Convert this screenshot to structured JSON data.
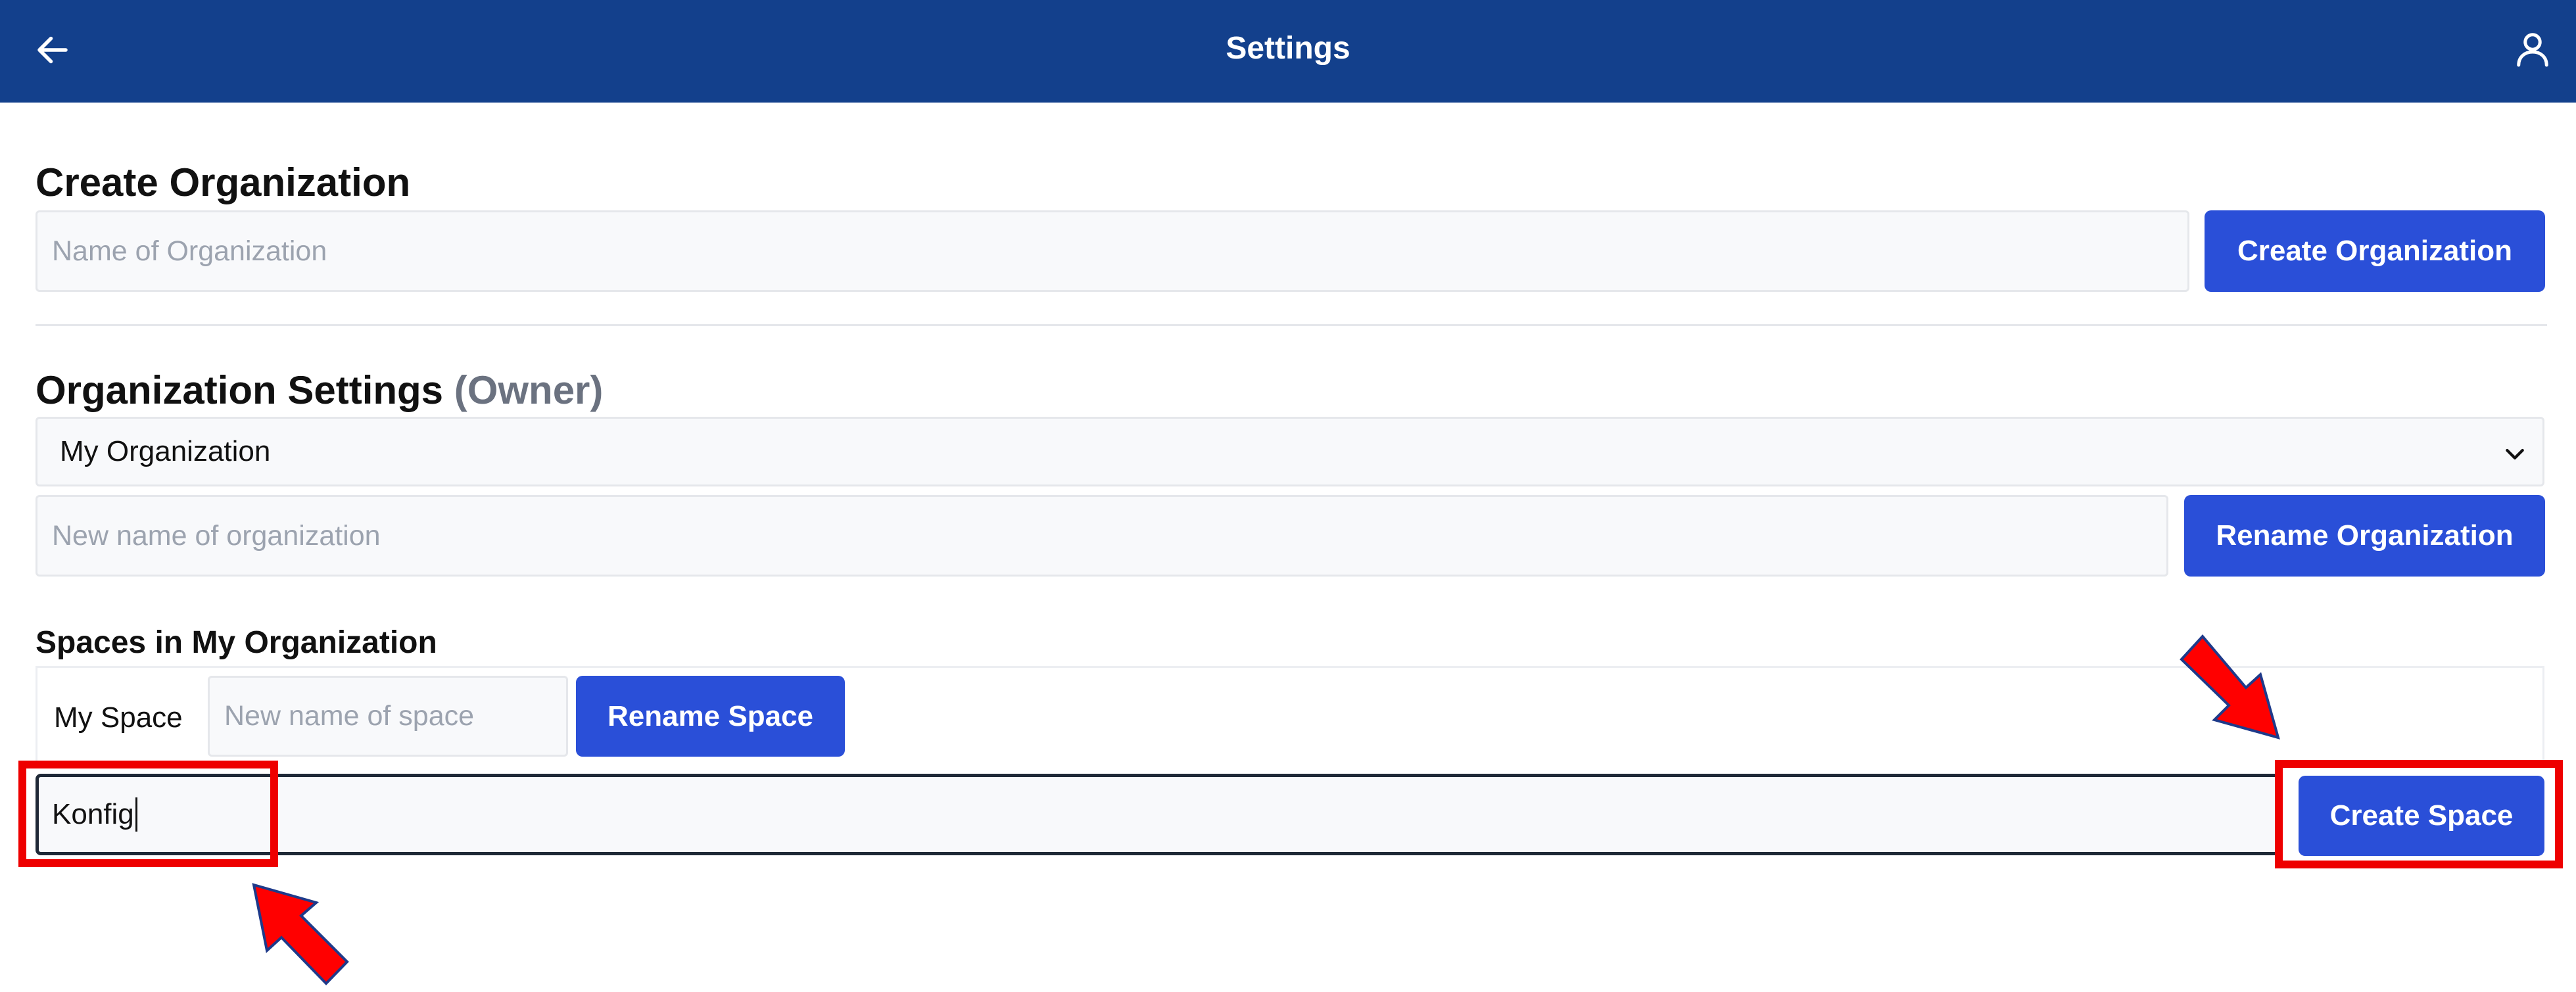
{
  "header": {
    "title": "Settings",
    "back_icon": "arrow-left-icon",
    "user_icon": "user-icon",
    "background": "#13408c"
  },
  "create_org": {
    "heading": "Create Organization",
    "input_placeholder": "Name of Organization",
    "input_value": "",
    "button_label": "Create Organization"
  },
  "org_settings": {
    "heading": "Organization Settings",
    "role": "(Owner)",
    "selected_org": "My Organization",
    "rename_placeholder": "New name of organization",
    "rename_button": "Rename Organization"
  },
  "spaces": {
    "heading": "Spaces in My Organization",
    "items": [
      {
        "name": "My Space",
        "rename_placeholder": "New name of space",
        "rename_button": "Rename Space"
      }
    ],
    "new_space_value": "Konfig",
    "create_button": "Create Space"
  },
  "annotations": {
    "highlight_color": "#ee0000",
    "arrow_color": "#ff0000",
    "arrow_outline": "#1e3a8a"
  },
  "colors": {
    "primary_button": "#2a4fd8",
    "input_bg": "#f8f9fb",
    "muted_text": "#6b7280"
  }
}
